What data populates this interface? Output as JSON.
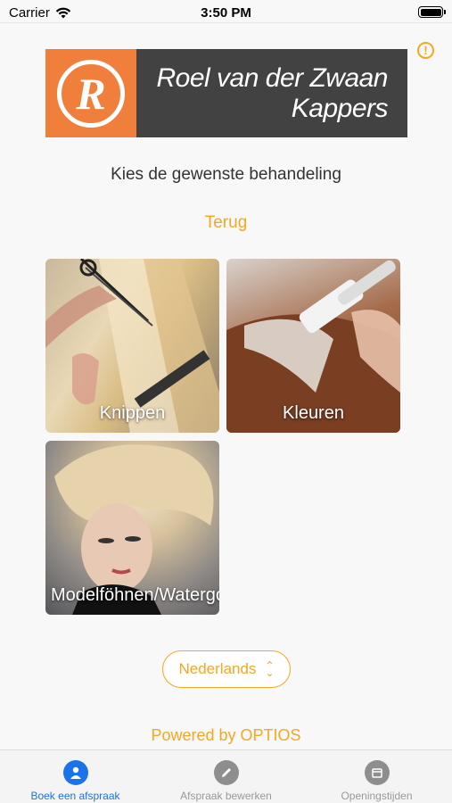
{
  "status": {
    "carrier": "Carrier",
    "time": "3:50 PM"
  },
  "header": {
    "logo_letter": "R",
    "logo_line1": "Roel van der Zwaan",
    "logo_line2": "Kappers",
    "info_symbol": "!"
  },
  "main": {
    "heading": "Kies de gewenste behandeling",
    "back_label": "Terug",
    "treatments": [
      {
        "label": "Knippen"
      },
      {
        "label": "Kleuren"
      },
      {
        "label": "Modelföhnen/Watergolf"
      }
    ]
  },
  "language": {
    "selected": "Nederlands"
  },
  "footer": {
    "powered_by": "Powered by OPTIOS"
  },
  "tabs": [
    {
      "label": "Boek een afspraak",
      "icon": "person-icon",
      "active": true
    },
    {
      "label": "Afspraak bewerken",
      "icon": "pencil-icon",
      "active": false
    },
    {
      "label": "Openingstijden",
      "icon": "calendar-icon",
      "active": false
    }
  ],
  "colors": {
    "accent": "#f5a623",
    "tab_active": "#1a73e8",
    "logo_orange": "#f07f3c",
    "logo_dark": "#424242"
  }
}
